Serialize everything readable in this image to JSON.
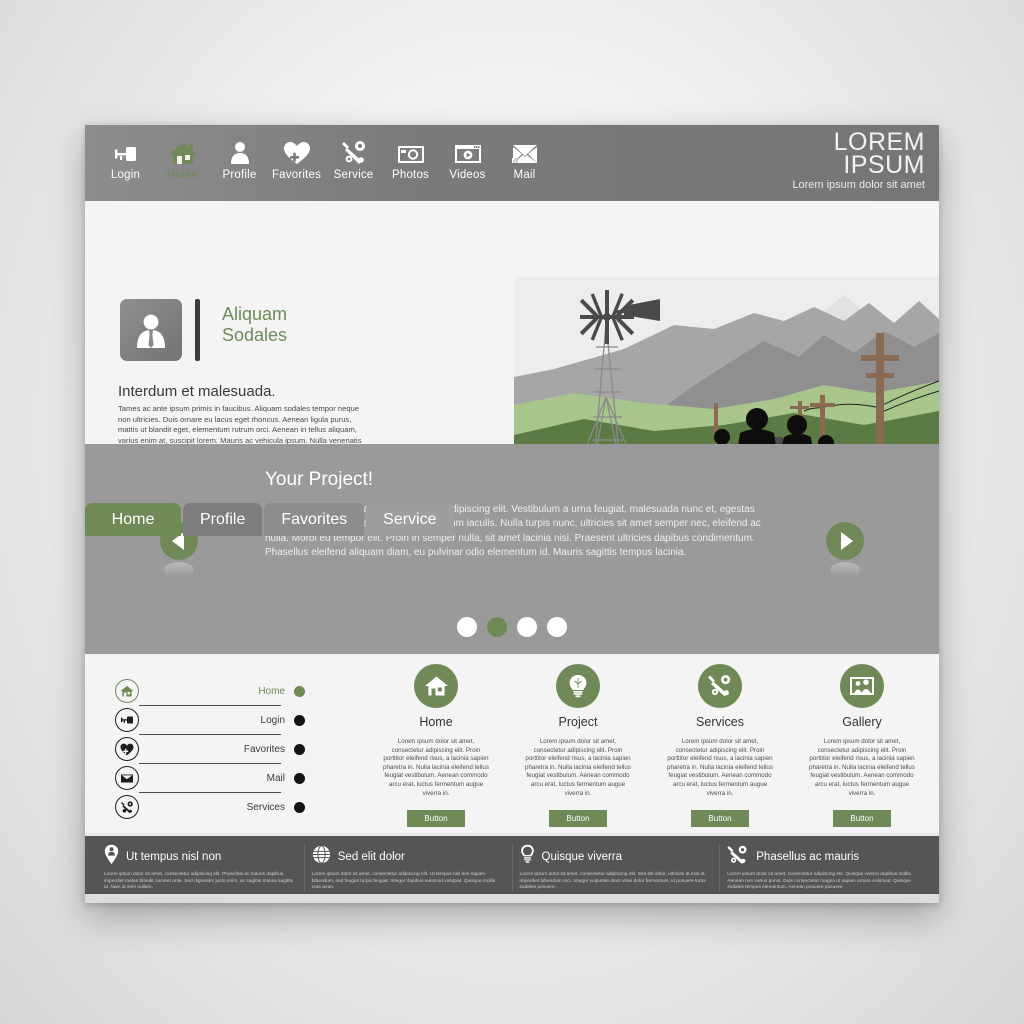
{
  "brand": {
    "line1": "LOREM",
    "line2": "IPSUM",
    "tagline": "Lorem ipsum dolor sit amet"
  },
  "topnav": [
    {
      "label": "Login",
      "icon": "key-icon",
      "active": false
    },
    {
      "label": "Home",
      "icon": "home-icon",
      "active": true
    },
    {
      "label": "Profile",
      "icon": "user-icon",
      "active": false
    },
    {
      "label": "Favorites",
      "icon": "heart-plus-icon",
      "active": false
    },
    {
      "label": "Service",
      "icon": "wrench-gear-icon",
      "active": false
    },
    {
      "label": "Photos",
      "icon": "camera-icon",
      "active": false
    },
    {
      "label": "Videos",
      "icon": "video-icon",
      "active": false
    },
    {
      "label": "Mail",
      "icon": "envelope-icon",
      "active": false
    }
  ],
  "intro": {
    "avatar_icon": "person-avatar-icon",
    "title_line1": "Aliquam",
    "title_line2": "Sodales",
    "subtitle": "Interdum et malesuada.",
    "body": "Tames ac ante ipsum primis in faucibus. Aliquam sodales tempor neque non ultricies. Duis ornare eu lacus eget rhoncus. Aenean ligula purus, mattis ut blandit eget, elementum rutrum orci. Aenean in tellus aliquam, varius enim at, suscipit lorem. Mauris ac vehicula ipsum. Nulla venenatis pharetra porttitor."
  },
  "tabs": [
    {
      "label": "Home",
      "active": true
    },
    {
      "label": "Profile",
      "active": false
    },
    {
      "label": "Favorites",
      "active": false
    },
    {
      "label": "Service",
      "active": false
    }
  ],
  "slider": {
    "title": "Your Project!",
    "body": "Lorem ipsum dolor sit amet, consectetur adipiscing elit. Vestibulum a urna feugiat, malesuada nunc et, egestas magna. Quisque id quam sed massa pretium iaculis. Nulla turpis nunc, ultricies sit amet semper nec, eleifend ac nulla. Morbi eu tempor elit. Proin in semper nulla, sit amet lacinia nisi. Praesent ultricies dapibus condimentum. Phasellus eleifend aliquam diam, eu pulvinar odio elementum id. Mauris sagittis tempus lacinia.",
    "prev_icon": "chevron-left-icon",
    "next_icon": "chevron-right-icon",
    "dots": [
      {
        "active": false
      },
      {
        "active": true
      },
      {
        "active": false
      },
      {
        "active": false
      }
    ]
  },
  "sidelist": [
    {
      "label": "Home",
      "icon": "home-icon",
      "active": true
    },
    {
      "label": "Login",
      "icon": "key-icon",
      "active": false
    },
    {
      "label": "Favorites",
      "icon": "heart-plus-icon",
      "active": false
    },
    {
      "label": "Mail",
      "icon": "envelope-icon",
      "active": false
    },
    {
      "label": "Services",
      "icon": "wrench-gear-icon",
      "active": false
    }
  ],
  "features": [
    {
      "title": "Home",
      "icon": "home-icon",
      "text": "Lorem ipsum dolor sit amet, consectetur adipiscing elit. Proin porttitor eleifend risus, a lacinia sapien pharetra in. Nulla lacinia eleifend tellus feugiat vestibulum. Aenean commodo arcu erat, luctus fermentum augue viverra in.",
      "button": "Button"
    },
    {
      "title": "Project",
      "icon": "lightbulb-icon",
      "text": "Lorem ipsum dolor sit amet, consectetur adipiscing elit. Proin porttitor eleifend risus, a lacinia sapien pharetra in. Nulla lacinia eleifend tellus feugiat vestibulum. Aenean commodo arcu erat, luctus fermentum augue viverra in.",
      "button": "Button"
    },
    {
      "title": "Services",
      "icon": "wrench-gear-icon",
      "text": "Lorem ipsum dolor sit amet, consectetur adipiscing elit. Proin porttitor eleifend risus, a lacinia sapien pharetra in. Nulla lacinia eleifend tellus feugiat vestibulum. Aenean commodo arcu erat, luctus fermentum augue viverra in.",
      "button": "Button"
    },
    {
      "title": "Gallery",
      "icon": "gallery-icon",
      "text": "Lorem ipsum dolor sit amet, consectetur adipiscing elit. Proin porttitor eleifend risus, a lacinia sapien pharetra in. Nulla lacinia eleifend tellus feugiat vestibulum. Aenean commodo arcu erat, luctus fermentum augue viverra in.",
      "button": "Button"
    }
  ],
  "footer": [
    {
      "title": "Ut tempus nisl non",
      "icon": "map-pin-person-icon",
      "text": "Lorem ipsum dolor sit amet, consectetur adipiscing elit. Phasellus ac mauris dapibus, imperdiet metus blandit, laoreet ante. Sed dignissim justo enim, ac sagittis massa sagittis id. Nam id sem nullam."
    },
    {
      "title": "Sed elit dolor",
      "icon": "globe-icon",
      "text": "Lorem ipsum dolor sit amet, consectetur adipiscing elit. Ut tempus nisl non sapien bibendum, sed feugiat turpis feugiat. Integer dapibus euismod volutpat. Quisque mollis cras amet."
    },
    {
      "title": "Quisque viverra",
      "icon": "lightbulb-icon",
      "text": "Lorem ipsum dolor sit amet, consectetur adipiscing elit. Sed elit dolor, ultricies at erat at, imperdiet bibendum orci. Integer vulputate diam vitae dolor fermentum, id posuere tortor sodales posuere."
    },
    {
      "title": "Phasellus ac mauris",
      "icon": "wrench-gear-icon",
      "text": "Lorem ipsum dolor sit amet, consectetur adipiscing elit. Quisque viverra dapibus mollis. Aenean non varius purus. Duis consectetur magna ut sapien ornare euismod. Quisque sodales tempus elementum. Aenean posuere posuere."
    }
  ],
  "colors": {
    "accent_green": "#6f8a56",
    "header_gray": "#787878",
    "slider_gray": "#9a9a9a",
    "footer_gray": "#555555",
    "page_bg": "#f4f4f4"
  }
}
